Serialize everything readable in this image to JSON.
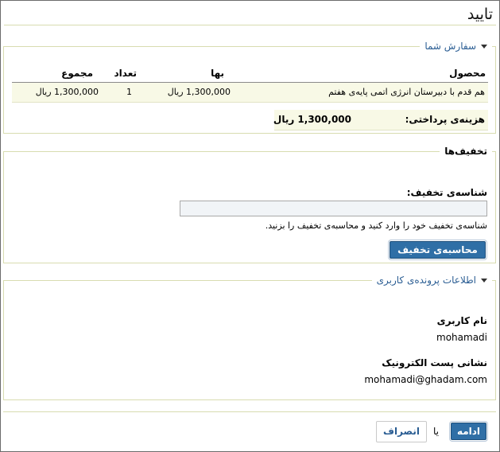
{
  "page": {
    "title": "تایید"
  },
  "order": {
    "legend": "سفارش شما",
    "columns": {
      "product": "محصول",
      "price": "بها",
      "qty": "تعداد",
      "total": "مجموع"
    },
    "items": [
      {
        "product": "هم قدم با دبیرستان انرژی اتمی پایه‌ی هفتم",
        "price": "1,300,000 ریال",
        "qty": "1",
        "total": "1,300,000 ریال"
      }
    ],
    "payment_label": "هزینه‌ی پرداختی:",
    "payment_value": "1,300,000 ریال"
  },
  "discounts": {
    "legend": "تخفیف‌ها",
    "code_label": "شناسه‌ی تخفیف:",
    "code_value": "",
    "hint": "شناسه‌ی تخفیف خود را وارد کنید و محاسبه‌ی تخفیف را بزنید.",
    "calc_button": "محاسبه‌ی تخفیف"
  },
  "profile": {
    "legend": "اطلاعات پرونده‌ی کاربری",
    "username_label": "نام کاربری",
    "username": "mohamadi",
    "email_label": "نشانی پست الکترونیک",
    "email": "mohamadi@ghadam.com"
  },
  "actions": {
    "continue": "ادامه",
    "or": "یا",
    "cancel": "انصراف"
  }
}
